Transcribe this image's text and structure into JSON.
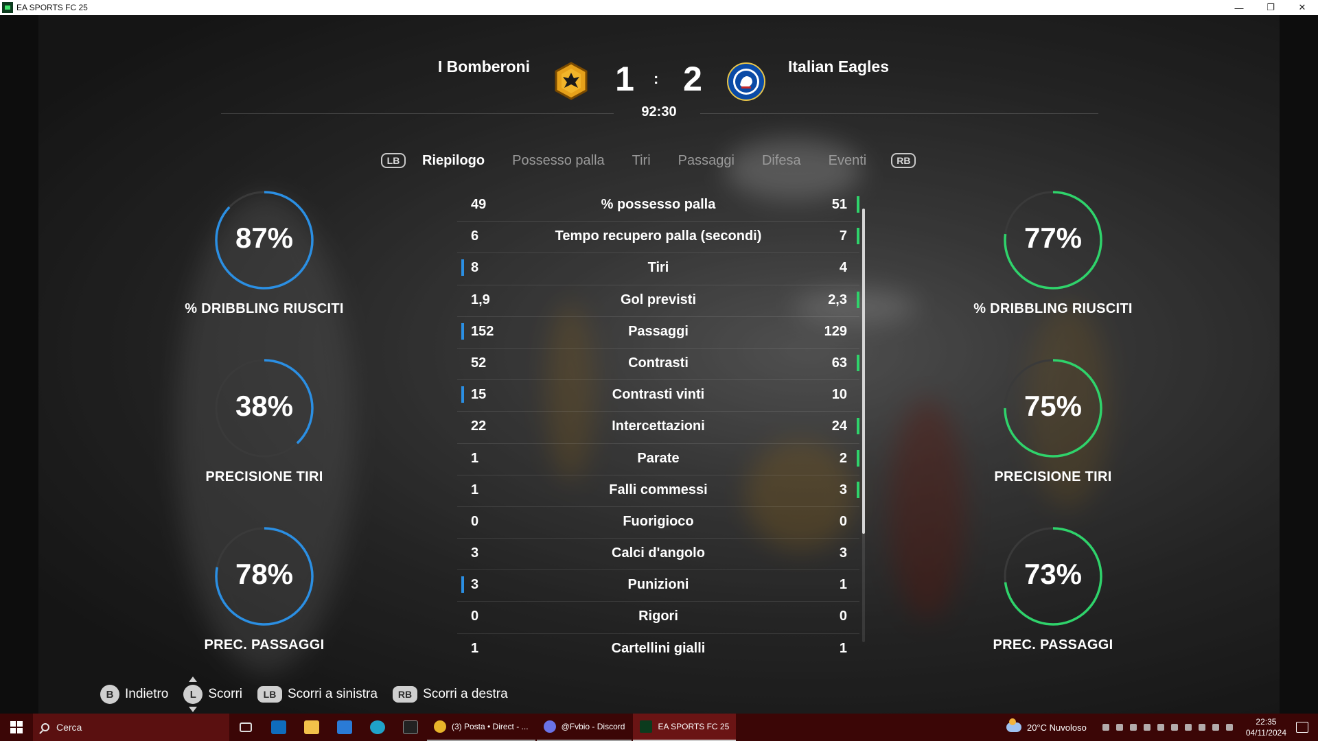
{
  "window": {
    "title": "EA SPORTS FC 25",
    "controls": {
      "minimize": "—",
      "restore": "❐",
      "close": "✕"
    }
  },
  "match": {
    "home_team": "I Bomberoni",
    "away_team": "Italian Eagles",
    "home_score": "1",
    "away_score": "2",
    "separator": ":",
    "clock": "92:30",
    "home_crest_icon": "eagle-crest-icon",
    "away_crest_icon": "lion-crest-icon"
  },
  "tabs": {
    "lb": "LB",
    "rb": "RB",
    "items": [
      "Riepilogo",
      "Possesso palla",
      "Tiri",
      "Passaggi",
      "Difesa",
      "Eventi"
    ],
    "active_index": 0
  },
  "stats": [
    {
      "left": "49",
      "label": "% possesso palla",
      "right": "51",
      "leader": "right"
    },
    {
      "left": "6",
      "label": "Tempo recupero palla (secondi)",
      "right": "7",
      "leader": "right"
    },
    {
      "left": "8",
      "label": "Tiri",
      "right": "4",
      "leader": "left"
    },
    {
      "left": "1,9",
      "label": "Gol previsti",
      "right": "2,3",
      "leader": "right"
    },
    {
      "left": "152",
      "label": "Passaggi",
      "right": "129",
      "leader": "left"
    },
    {
      "left": "52",
      "label": "Contrasti",
      "right": "63",
      "leader": "right"
    },
    {
      "left": "15",
      "label": "Contrasti vinti",
      "right": "10",
      "leader": "left"
    },
    {
      "left": "22",
      "label": "Intercettazioni",
      "right": "24",
      "leader": "right"
    },
    {
      "left": "1",
      "label": "Parate",
      "right": "2",
      "leader": "right"
    },
    {
      "left": "1",
      "label": "Falli commessi",
      "right": "3",
      "leader": "right"
    },
    {
      "left": "0",
      "label": "Fuorigioco",
      "right": "0",
      "leader": "none"
    },
    {
      "left": "3",
      "label": "Calci d'angolo",
      "right": "3",
      "leader": "none"
    },
    {
      "left": "3",
      "label": "Punizioni",
      "right": "1",
      "leader": "left"
    },
    {
      "left": "0",
      "label": "Rigori",
      "right": "0",
      "leader": "none"
    },
    {
      "left": "1",
      "label": "Cartellini gialli",
      "right": "1",
      "leader": "none"
    }
  ],
  "gauges": {
    "home_color": "#2b8fe3",
    "away_color": "#2fd36b",
    "home": [
      {
        "value": "87%",
        "pct": 87,
        "label": "% DRIBBLING RIUSCITI"
      },
      {
        "value": "38%",
        "pct": 38,
        "label": "PRECISIONE TIRI"
      },
      {
        "value": "78%",
        "pct": 78,
        "label": "PREC. PASSAGGI"
      }
    ],
    "away": [
      {
        "value": "77%",
        "pct": 77,
        "label": "% DRIBBLING RIUSCITI"
      },
      {
        "value": "75%",
        "pct": 75,
        "label": "PRECISIONE TIRI"
      },
      {
        "value": "73%",
        "pct": 73,
        "label": "PREC. PASSAGGI"
      }
    ]
  },
  "footer": {
    "back_key": "B",
    "back_label": "Indietro",
    "scroll_key": "L",
    "scroll_label": "Scorri",
    "left_key": "LB",
    "left_label": "Scorri a sinistra",
    "right_key": "RB",
    "right_label": "Scorri a destra"
  },
  "taskbar": {
    "search_placeholder": "Cerca",
    "apps": [
      {
        "label": "(3) Posta • Direct - ...",
        "icon": "chrome-icon",
        "color": "#e8b42a",
        "active": false
      },
      {
        "label": "@Fvbio - Discord",
        "icon": "discord-icon",
        "color": "#6a73e8",
        "active": false
      },
      {
        "label": "EA SPORTS FC 25",
        "icon": "fc25-icon",
        "color": "#0b3b1d",
        "active": true
      }
    ],
    "weather": "20°C  Nuvoloso",
    "time": "22:35",
    "date": "04/11/2024"
  }
}
